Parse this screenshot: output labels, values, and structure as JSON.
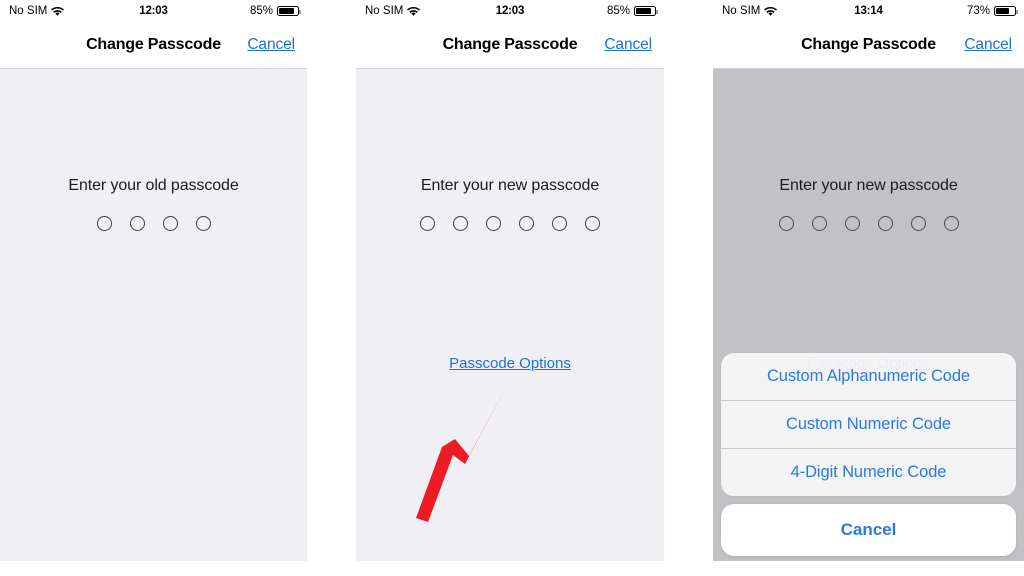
{
  "panels": [
    {
      "id": "panel-old-passcode",
      "dimmed": false,
      "status": {
        "carrier": "No SIM",
        "wifi_icon": "wifi-icon",
        "time": "12:03",
        "battery_percent": "85%",
        "battery_level": 85,
        "battery_icon": "battery-icon"
      },
      "nav": {
        "title": "Change Passcode",
        "cancel_label": "Cancel"
      },
      "prompt": "Enter your old passcode",
      "dot_count": 4,
      "passcode_options_label": "",
      "show_passcode_options": false,
      "show_arrow": false,
      "show_action_sheet": false
    },
    {
      "id": "panel-new-passcode",
      "dimmed": false,
      "status": {
        "carrier": "No SIM",
        "wifi_icon": "wifi-icon",
        "time": "12:03",
        "battery_percent": "85%",
        "battery_level": 85,
        "battery_icon": "battery-icon"
      },
      "nav": {
        "title": "Change Passcode",
        "cancel_label": "Cancel"
      },
      "prompt": "Enter your new passcode",
      "dot_count": 6,
      "passcode_options_label": "Passcode Options",
      "show_passcode_options": true,
      "show_arrow": true,
      "show_action_sheet": false
    },
    {
      "id": "panel-passcode-options-sheet",
      "dimmed": true,
      "status": {
        "carrier": "No SIM",
        "wifi_icon": "wifi-icon",
        "time": "13:14",
        "battery_percent": "73%",
        "battery_level": 73,
        "battery_icon": "battery-icon"
      },
      "nav": {
        "title": "Change Passcode",
        "cancel_label": "Cancel"
      },
      "prompt": "Enter your new passcode",
      "dot_count": 6,
      "passcode_options_label": "Passcode Options",
      "show_passcode_options": true,
      "show_arrow": false,
      "show_action_sheet": true,
      "action_sheet": {
        "options": [
          "Custom Alphanumeric Code",
          "Custom Numeric Code",
          "4-Digit Numeric Code"
        ],
        "cancel_label": "Cancel"
      }
    }
  ],
  "annotation": {
    "arrow_icon": "red-arrow-icon",
    "arrow_color": "#ed1c24",
    "points_to": "Passcode Options"
  },
  "colors": {
    "link_blue": "#1a73d4",
    "sheet_blue": "#2a7ae2",
    "content_bg": "#f0eff4",
    "dimmed_bg": "#c2c2c6",
    "navbar_bg": "#ffffff",
    "arrow_red": "#ed1c24"
  }
}
